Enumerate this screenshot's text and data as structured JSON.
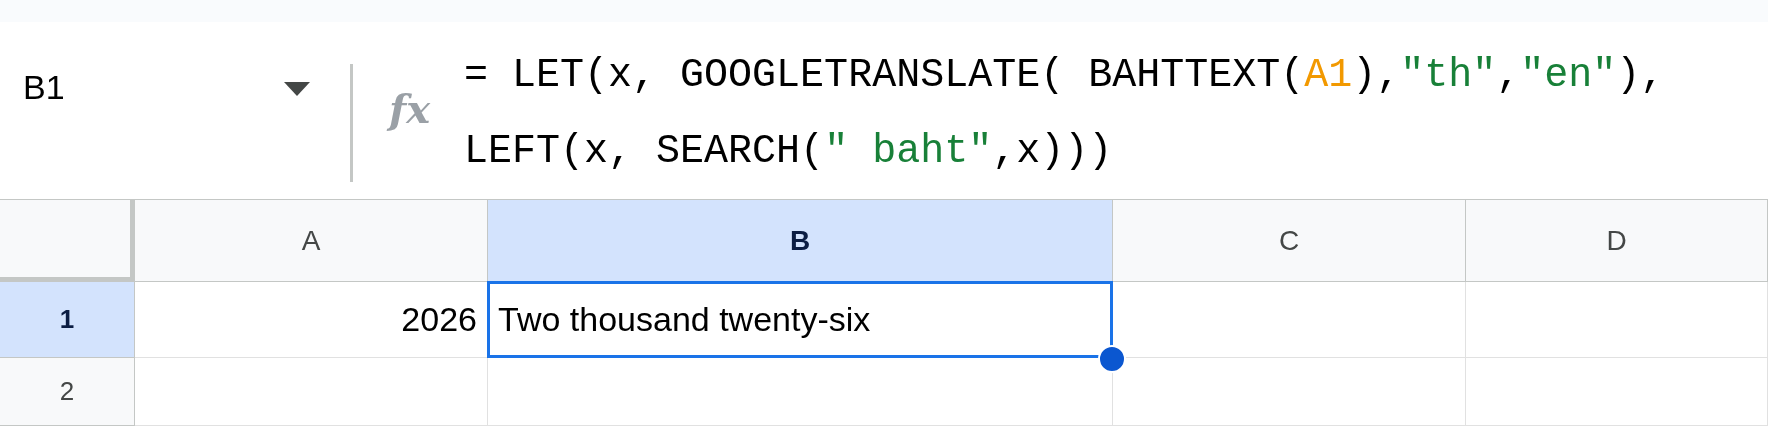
{
  "formula_bar": {
    "name_box": "B1",
    "fx_label": "fx",
    "lines": [
      [
        {
          "kind": "plain",
          "text": "= LET(x, GOOGLETRANSLATE( BAHTTEXT("
        },
        {
          "kind": "ref",
          "text": "A1"
        },
        {
          "kind": "plain",
          "text": "),"
        },
        {
          "kind": "string",
          "text": "\"th\""
        },
        {
          "kind": "plain",
          "text": ","
        },
        {
          "kind": "string",
          "text": "\"en\""
        },
        {
          "kind": "plain",
          "text": "),"
        }
      ],
      [
        {
          "kind": "plain",
          "text": "LEFT(x, SEARCH("
        },
        {
          "kind": "string",
          "text": "\" baht\""
        },
        {
          "kind": "plain",
          "text": ",x)))"
        }
      ]
    ]
  },
  "columns": [
    {
      "label": "A",
      "selected": false
    },
    {
      "label": "B",
      "selected": true
    },
    {
      "label": "C",
      "selected": false
    },
    {
      "label": "D",
      "selected": false
    }
  ],
  "rows": [
    {
      "label": "1",
      "selected": true,
      "cells": [
        {
          "kind": "number",
          "value": "2026",
          "active": false
        },
        {
          "kind": "text",
          "value": "Two thousand twenty-six",
          "active": true
        }
      ]
    },
    {
      "label": "2",
      "selected": false,
      "cells": []
    }
  ]
}
